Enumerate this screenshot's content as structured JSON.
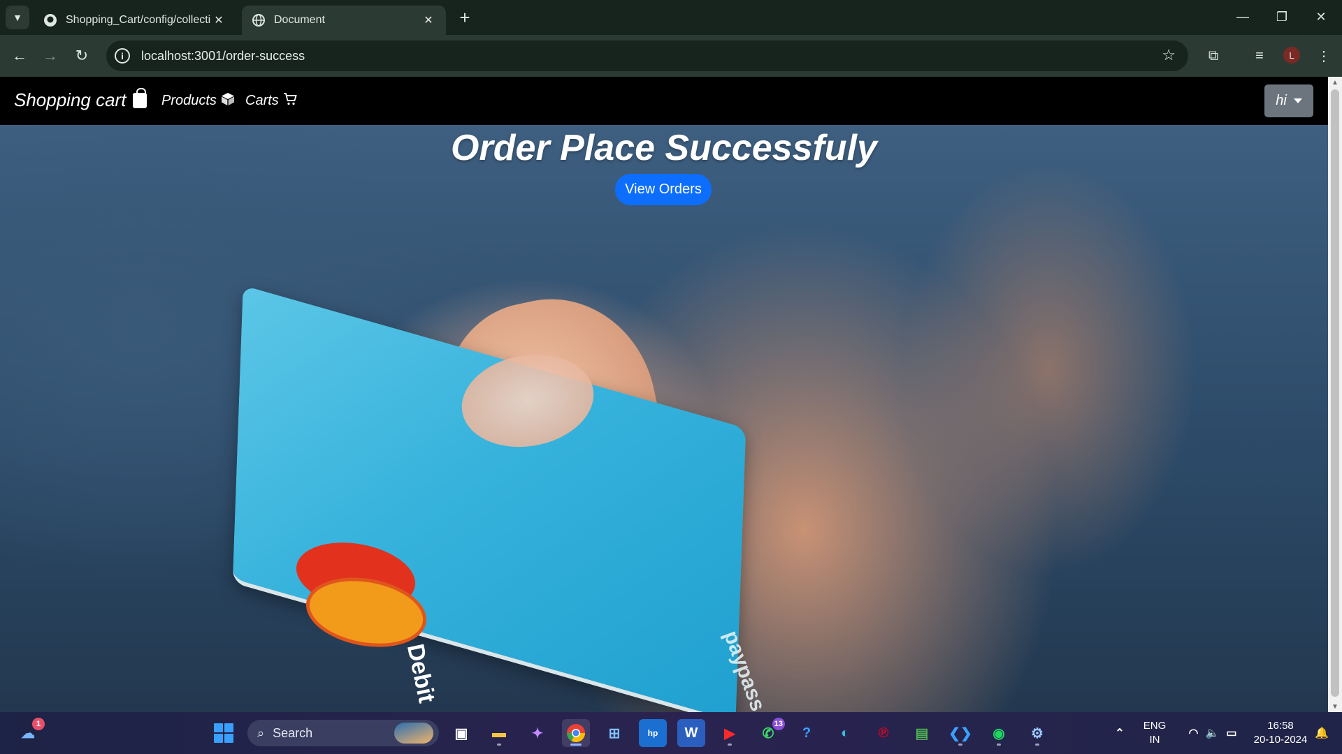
{
  "browser": {
    "tabs": [
      {
        "title": "Shopping_Cart/config/collectio",
        "icon": "github-icon",
        "active": false
      },
      {
        "title": "Document",
        "icon": "globe-icon",
        "active": true
      }
    ],
    "url": "localhost:3001/order-success",
    "profile_initial": "L"
  },
  "navbar": {
    "brand": "Shopping cart",
    "links": [
      {
        "label": "Products",
        "icon": "cube-icon"
      },
      {
        "label": "Carts",
        "icon": "cart-icon"
      }
    ],
    "user_dropdown": "hi"
  },
  "hero": {
    "headline": "Order Place Successfuly",
    "button": "View Orders",
    "card_text": "Debit",
    "card_brand": "paypass"
  },
  "taskbar": {
    "search_placeholder": "Search",
    "widget_badge": "1",
    "whatsapp_badge": "13",
    "language": "ENG",
    "region": "IN",
    "time": "16:58",
    "date": "20-10-2024"
  },
  "colors": {
    "accent_button": "#0d6efd",
    "navbar_bg": "#000000",
    "dropdown_bg": "#6c757d"
  }
}
